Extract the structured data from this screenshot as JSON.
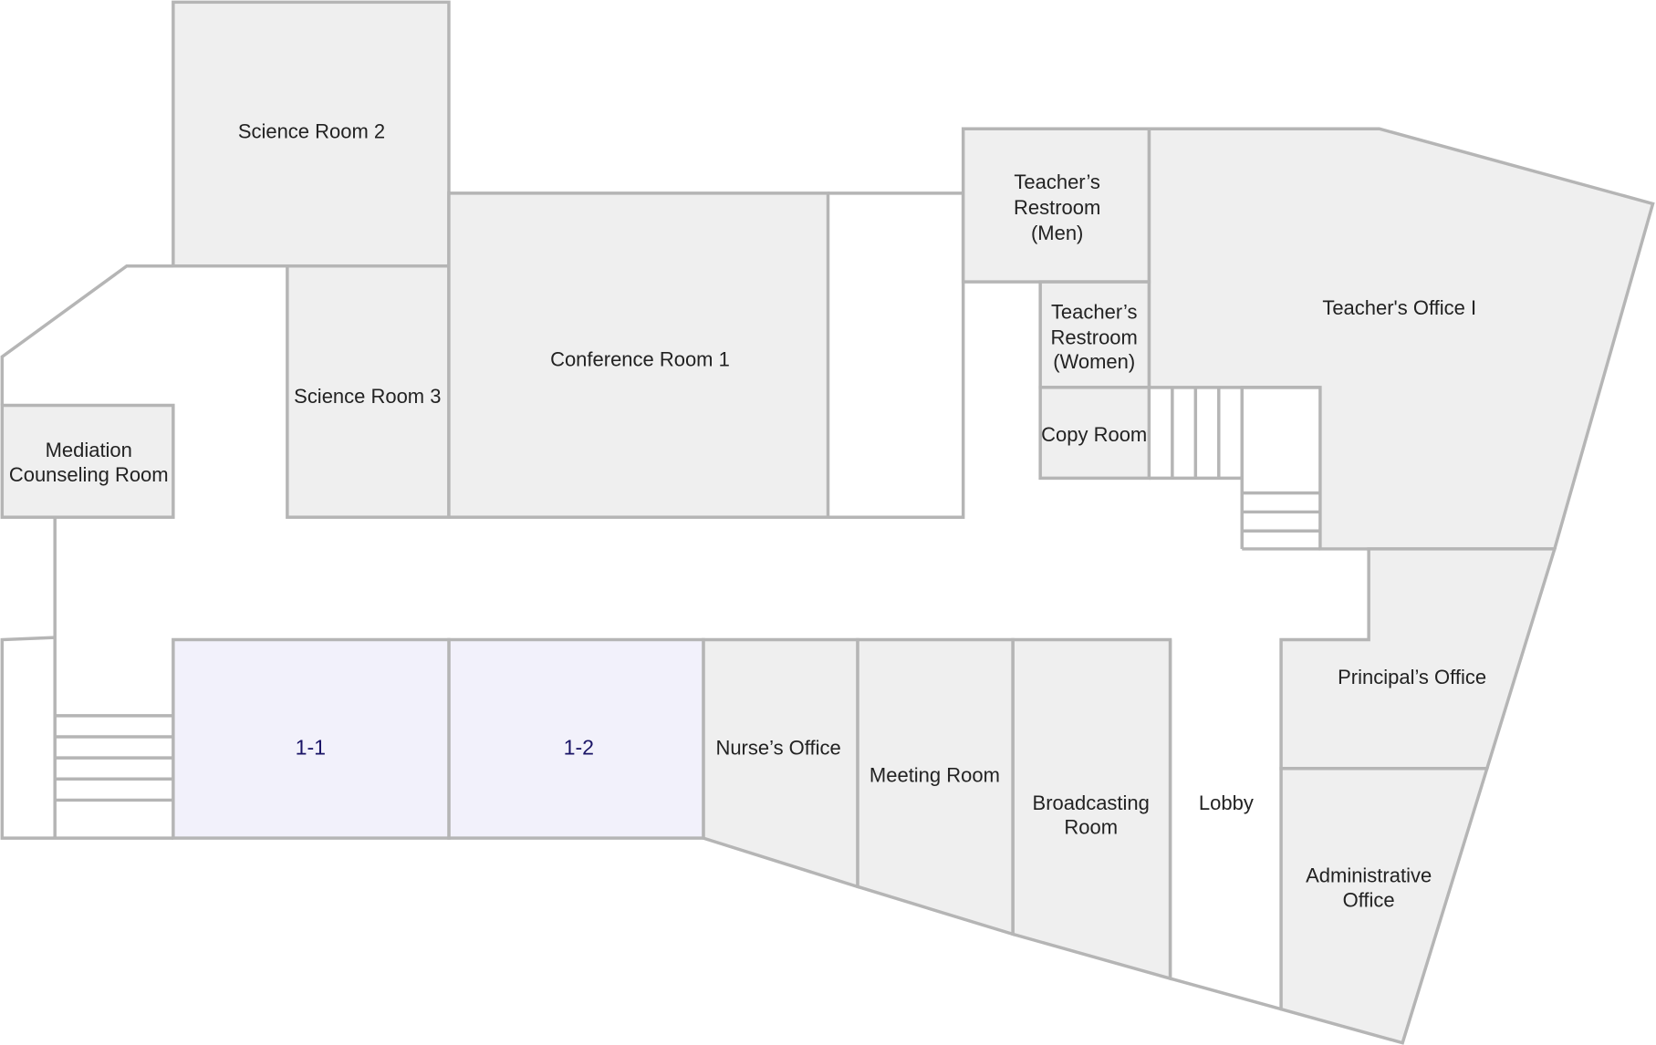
{
  "colors": {
    "room_fill": "#efefef",
    "classroom_fill": "#f2f1fb",
    "wall": "#b5b5b5",
    "classroom_text": "#1a1466"
  },
  "rooms": {
    "science_room_2": "Science Room 2",
    "science_room_3": "Science Room 3",
    "conference_room_1": "Conference Room 1",
    "mediation_1": "Mediation",
    "mediation_2": "Counseling Room",
    "restroom_men_1": "Teacher’s",
    "restroom_men_2": "Restroom",
    "restroom_men_3": "(Men)",
    "restroom_women_1": "Teacher’s",
    "restroom_women_2": "Restroom",
    "restroom_women_3": "(Women)",
    "copy_room": "Copy Room",
    "teachers_office": "Teacher's Office I",
    "principals_office": "Principal’s Office",
    "admin_1": "Administrative",
    "admin_2": "Office",
    "lobby": "Lobby",
    "broadcasting_1": "Broadcasting",
    "broadcasting_2": "Room",
    "meeting_room": "Meeting Room",
    "nurses_office": "Nurse’s Office",
    "class_1_1": "1-1",
    "class_1_2": "1-2"
  }
}
